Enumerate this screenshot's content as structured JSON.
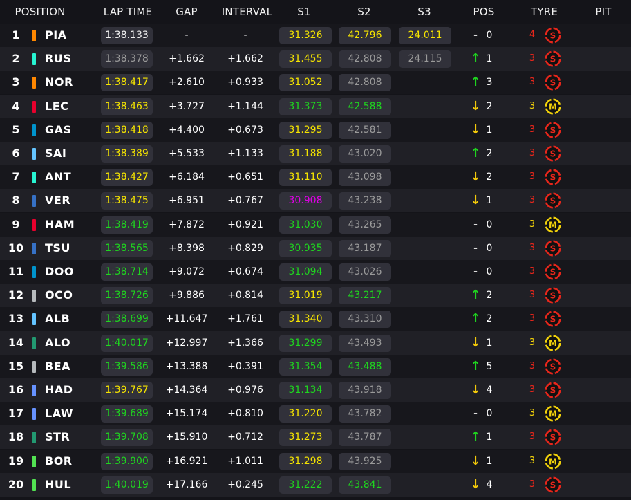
{
  "headers": {
    "position": "POSITION",
    "lap_time": "LAP TIME",
    "gap": "GAP",
    "interval": "INTERVAL",
    "s1": "S1",
    "s2": "S2",
    "s3": "S3",
    "pos": "POS",
    "tyre": "TYRE",
    "pit": "PIT"
  },
  "colors": {
    "yellow": "#f5e400",
    "green": "#1fd41f",
    "white": "#f1f1f1",
    "grey": "#9a9a9a",
    "purple": "#e100e8",
    "soft_tyre": "#e8261b",
    "medium_tyre": "#f2d20a",
    "laps_red": "#e8261b",
    "laps_yellow": "#f2d20a"
  },
  "rows": [
    {
      "pos": "1",
      "driver": "PIA",
      "team_color": "#ff8700",
      "lap": "1:38.133",
      "lap_c": "w",
      "gap": "-",
      "interval": "-",
      "s1": "31.326",
      "s1_c": "y",
      "s2": "42.796",
      "s2_c": "y",
      "s3": "24.011",
      "s3_c": "y",
      "change": "0",
      "dir": "none",
      "laps": "4",
      "tyre": "S"
    },
    {
      "pos": "2",
      "driver": "RUS",
      "team_color": "#27f4d2",
      "lap": "1:38.378",
      "lap_c": "gr",
      "gap": "+1.662",
      "interval": "+1.662",
      "s1": "31.455",
      "s1_c": "y",
      "s2": "42.808",
      "s2_c": "gr",
      "s3": "24.115",
      "s3_c": "gr",
      "change": "1",
      "dir": "up",
      "laps": "3",
      "tyre": "S"
    },
    {
      "pos": "3",
      "driver": "NOR",
      "team_color": "#ff8700",
      "lap": "1:38.417",
      "lap_c": "y",
      "gap": "+2.610",
      "interval": "+0.933",
      "s1": "31.052",
      "s1_c": "y",
      "s2": "42.808",
      "s2_c": "gr",
      "s3": "",
      "s3_c": "w",
      "change": "3",
      "dir": "up",
      "laps": "3",
      "tyre": "S"
    },
    {
      "pos": "4",
      "driver": "LEC",
      "team_color": "#e8002d",
      "lap": "1:38.463",
      "lap_c": "y",
      "gap": "+3.727",
      "interval": "+1.144",
      "s1": "31.373",
      "s1_c": "g",
      "s2": "42.588",
      "s2_c": "g",
      "s3": "",
      "s3_c": "w",
      "change": "2",
      "dir": "down",
      "laps": "3",
      "tyre": "M"
    },
    {
      "pos": "5",
      "driver": "GAS",
      "team_color": "#0093cc",
      "lap": "1:38.418",
      "lap_c": "y",
      "gap": "+4.400",
      "interval": "+0.673",
      "s1": "31.295",
      "s1_c": "y",
      "s2": "42.581",
      "s2_c": "gr",
      "s3": "",
      "s3_c": "w",
      "change": "1",
      "dir": "down",
      "laps": "3",
      "tyre": "S"
    },
    {
      "pos": "6",
      "driver": "SAI",
      "team_color": "#64c4ff",
      "lap": "1:38.389",
      "lap_c": "y",
      "gap": "+5.533",
      "interval": "+1.133",
      "s1": "31.188",
      "s1_c": "y",
      "s2": "43.020",
      "s2_c": "gr",
      "s3": "",
      "s3_c": "w",
      "change": "2",
      "dir": "up",
      "laps": "3",
      "tyre": "S"
    },
    {
      "pos": "7",
      "driver": "ANT",
      "team_color": "#27f4d2",
      "lap": "1:38.427",
      "lap_c": "y",
      "gap": "+6.184",
      "interval": "+0.651",
      "s1": "31.110",
      "s1_c": "y",
      "s2": "43.098",
      "s2_c": "gr",
      "s3": "",
      "s3_c": "w",
      "change": "2",
      "dir": "down",
      "laps": "3",
      "tyre": "S"
    },
    {
      "pos": "8",
      "driver": "VER",
      "team_color": "#3671c6",
      "lap": "1:38.475",
      "lap_c": "y",
      "gap": "+6.951",
      "interval": "+0.767",
      "s1": "30.908",
      "s1_c": "p",
      "s2": "43.238",
      "s2_c": "gr",
      "s3": "",
      "s3_c": "w",
      "change": "1",
      "dir": "down",
      "laps": "3",
      "tyre": "S"
    },
    {
      "pos": "9",
      "driver": "HAM",
      "team_color": "#e8002d",
      "lap": "1:38.419",
      "lap_c": "g",
      "gap": "+7.872",
      "interval": "+0.921",
      "s1": "31.030",
      "s1_c": "g",
      "s2": "43.265",
      "s2_c": "gr",
      "s3": "",
      "s3_c": "w",
      "change": "0",
      "dir": "none",
      "laps": "3",
      "tyre": "M"
    },
    {
      "pos": "10",
      "driver": "TSU",
      "team_color": "#3671c6",
      "lap": "1:38.565",
      "lap_c": "g",
      "gap": "+8.398",
      "interval": "+0.829",
      "s1": "30.935",
      "s1_c": "g",
      "s2": "43.187",
      "s2_c": "gr",
      "s3": "",
      "s3_c": "w",
      "change": "0",
      "dir": "none",
      "laps": "3",
      "tyre": "S"
    },
    {
      "pos": "11",
      "driver": "DOO",
      "team_color": "#0093cc",
      "lap": "1:38.714",
      "lap_c": "g",
      "gap": "+9.072",
      "interval": "+0.674",
      "s1": "31.094",
      "s1_c": "g",
      "s2": "43.026",
      "s2_c": "gr",
      "s3": "",
      "s3_c": "w",
      "change": "0",
      "dir": "none",
      "laps": "3",
      "tyre": "S"
    },
    {
      "pos": "12",
      "driver": "OCO",
      "team_color": "#b6babd",
      "lap": "1:38.726",
      "lap_c": "g",
      "gap": "+9.886",
      "interval": "+0.814",
      "s1": "31.019",
      "s1_c": "y",
      "s2": "43.217",
      "s2_c": "g",
      "s3": "",
      "s3_c": "w",
      "change": "2",
      "dir": "up",
      "laps": "3",
      "tyre": "S"
    },
    {
      "pos": "13",
      "driver": "ALB",
      "team_color": "#64c4ff",
      "lap": "1:38.699",
      "lap_c": "g",
      "gap": "+11.647",
      "interval": "+1.761",
      "s1": "31.340",
      "s1_c": "y",
      "s2": "43.310",
      "s2_c": "gr",
      "s3": "",
      "s3_c": "w",
      "change": "2",
      "dir": "up",
      "laps": "3",
      "tyre": "S"
    },
    {
      "pos": "14",
      "driver": "ALO",
      "team_color": "#229971",
      "lap": "1:40.017",
      "lap_c": "g",
      "gap": "+12.997",
      "interval": "+1.366",
      "s1": "31.299",
      "s1_c": "g",
      "s2": "43.493",
      "s2_c": "gr",
      "s3": "",
      "s3_c": "w",
      "change": "1",
      "dir": "down",
      "laps": "3",
      "tyre": "M"
    },
    {
      "pos": "15",
      "driver": "BEA",
      "team_color": "#b6babd",
      "lap": "1:39.586",
      "lap_c": "g",
      "gap": "+13.388",
      "interval": "+0.391",
      "s1": "31.354",
      "s1_c": "g",
      "s2": "43.488",
      "s2_c": "g",
      "s3": "",
      "s3_c": "w",
      "change": "5",
      "dir": "up",
      "laps": "3",
      "tyre": "S"
    },
    {
      "pos": "16",
      "driver": "HAD",
      "team_color": "#6692ff",
      "lap": "1:39.767",
      "lap_c": "y",
      "gap": "+14.364",
      "interval": "+0.976",
      "s1": "31.134",
      "s1_c": "g",
      "s2": "43.918",
      "s2_c": "gr",
      "s3": "",
      "s3_c": "w",
      "change": "4",
      "dir": "down",
      "laps": "3",
      "tyre": "S"
    },
    {
      "pos": "17",
      "driver": "LAW",
      "team_color": "#6692ff",
      "lap": "1:39.689",
      "lap_c": "g",
      "gap": "+15.174",
      "interval": "+0.810",
      "s1": "31.220",
      "s1_c": "y",
      "s2": "43.782",
      "s2_c": "gr",
      "s3": "",
      "s3_c": "w",
      "change": "0",
      "dir": "none",
      "laps": "3",
      "tyre": "M"
    },
    {
      "pos": "18",
      "driver": "STR",
      "team_color": "#229971",
      "lap": "1:39.708",
      "lap_c": "g",
      "gap": "+15.910",
      "interval": "+0.712",
      "s1": "31.273",
      "s1_c": "y",
      "s2": "43.787",
      "s2_c": "gr",
      "s3": "",
      "s3_c": "w",
      "change": "1",
      "dir": "up",
      "laps": "3",
      "tyre": "S"
    },
    {
      "pos": "19",
      "driver": "BOR",
      "team_color": "#52e252",
      "lap": "1:39.900",
      "lap_c": "g",
      "gap": "+16.921",
      "interval": "+1.011",
      "s1": "31.298",
      "s1_c": "y",
      "s2": "43.925",
      "s2_c": "gr",
      "s3": "",
      "s3_c": "w",
      "change": "1",
      "dir": "down",
      "laps": "3",
      "tyre": "M"
    },
    {
      "pos": "20",
      "driver": "HUL",
      "team_color": "#52e252",
      "lap": "1:40.019",
      "lap_c": "g",
      "gap": "+17.166",
      "interval": "+0.245",
      "s1": "31.222",
      "s1_c": "g",
      "s2": "43.841",
      "s2_c": "g",
      "s3": "",
      "s3_c": "w",
      "change": "4",
      "dir": "down",
      "laps": "3",
      "tyre": "S"
    }
  ]
}
